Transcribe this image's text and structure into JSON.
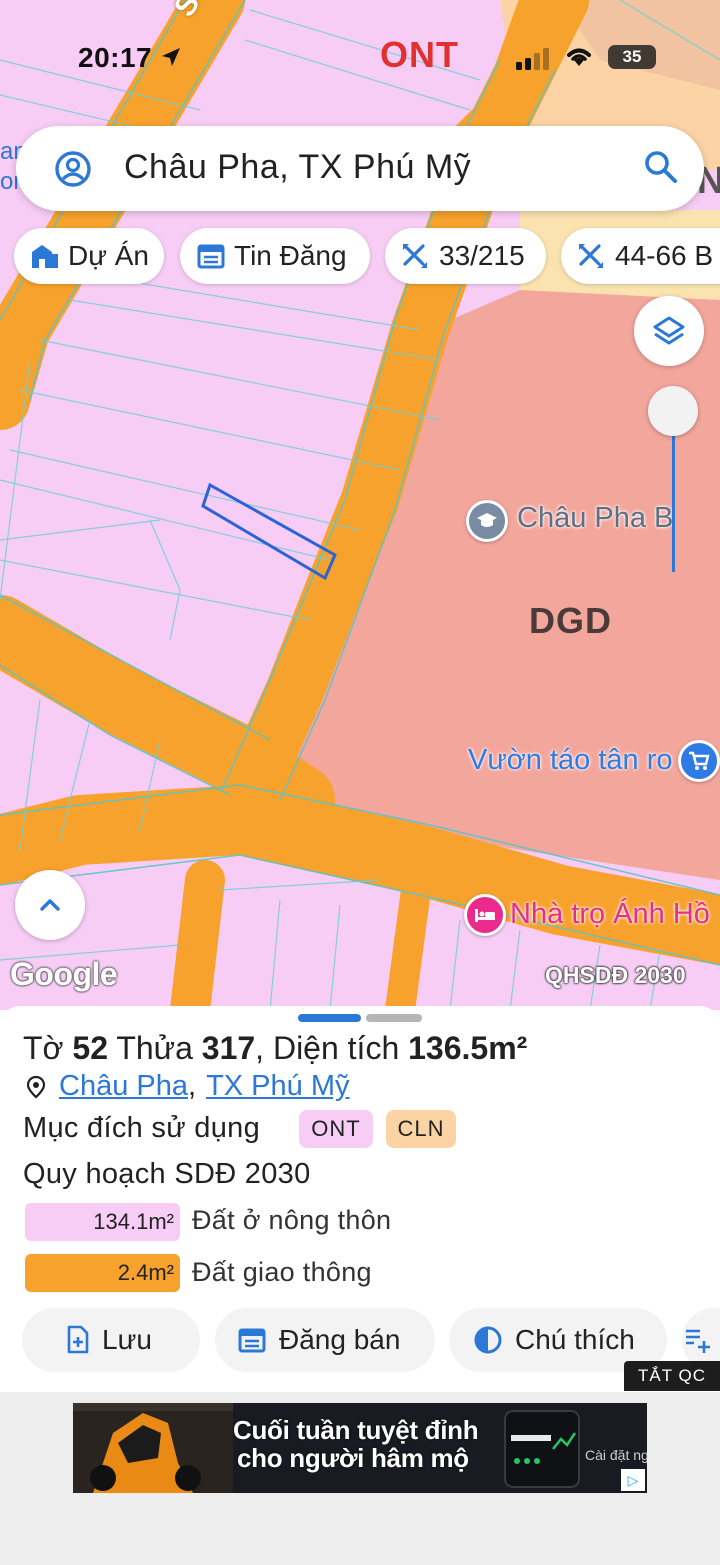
{
  "status_bar": {
    "time": "20:17",
    "battery": "35"
  },
  "map": {
    "zone_label_top": "ONT",
    "river_label": "Sông",
    "zone_label_center": "DGD",
    "edge_text_left_1": "an",
    "edge_text_left_2": "on",
    "edge_text_right": "N",
    "poi_school": "Châu Pha B",
    "poi_shop": "Vườn táo tân ro",
    "poi_hotel": "Nhà trọ Ánh Hồ",
    "google_logo": "Google",
    "layer_badge": "QHSDĐ 2030",
    "colors": {
      "residential": "#f7cdf6",
      "road": "#f7a22c",
      "education": "#f3a69c",
      "parcel_outline": "#2b63d6"
    }
  },
  "search": {
    "value": "Châu Pha, TX Phú Mỹ"
  },
  "chips": [
    {
      "label": "Dự Án",
      "icon": "building-icon"
    },
    {
      "label": "Tin Đăng",
      "icon": "calendar-icon"
    },
    {
      "label": "33/215",
      "icon": "ruler-icon"
    },
    {
      "label": "44-66 B",
      "icon": "ruler-icon"
    }
  ],
  "sheet": {
    "title": {
      "to_label": "Tờ",
      "to_value": "52",
      "thua_label": "Thửa",
      "thua_value": "317",
      "area_label": "Diện tích",
      "area_value": "136.5m²"
    },
    "commune": "Châu Pha",
    "district": "TX Phú Mỹ",
    "purpose_label": "Mục đích sử dụng",
    "purpose_tags": [
      {
        "code": "ONT",
        "color": "#f7cdf6"
      },
      {
        "code": "CLN",
        "color": "#fbd3a5"
      }
    ],
    "plan_label": "Quy hoạch SDĐ 2030",
    "plan_rows": [
      {
        "area": "134.1m²",
        "label": "Đất ở nông thôn",
        "color": "#f7cdf6"
      },
      {
        "area": "2.4m²",
        "label": "Đất giao thông",
        "color": "#f7a22c"
      }
    ]
  },
  "actions": [
    {
      "label": "Lưu",
      "icon": "save-file-icon"
    },
    {
      "label": "Đăng bán",
      "icon": "calendar-icon"
    },
    {
      "label": "Chú thích",
      "icon": "half-circle-icon"
    },
    {
      "label": "",
      "icon": "add-icon"
    }
  ],
  "ad": {
    "close_label": "TẮT QC",
    "headline_1": "Cuối tuần tuyệt đỉnh",
    "headline_2": "cho người hâm mộ",
    "cta": "Cài đặt ngay"
  }
}
